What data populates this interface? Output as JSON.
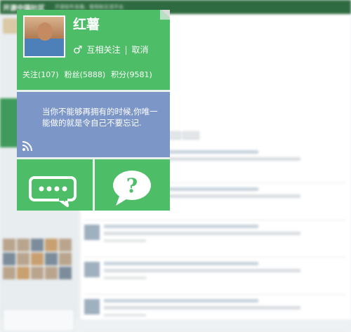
{
  "site": {
    "logo": "开源中国社区",
    "tagline": "开源软件发展、使用和交流平台"
  },
  "profile": {
    "name": "红薯",
    "gender_icon": "male-icon",
    "relation": "互相关注",
    "separator": "|",
    "cancel": "取消",
    "stats": {
      "following": "关注(107)",
      "fans": "粉丝(5888)",
      "points": "积分(9581)"
    },
    "bio": "当你不能够再拥有的时候,你唯一能做的就是令自己不要忘记."
  },
  "actions": {
    "message_icon": "message-bubble-icon",
    "ask_icon": "question-bubble-icon"
  },
  "colors": {
    "green": "#4dbd67",
    "blue": "#7b96c7"
  }
}
